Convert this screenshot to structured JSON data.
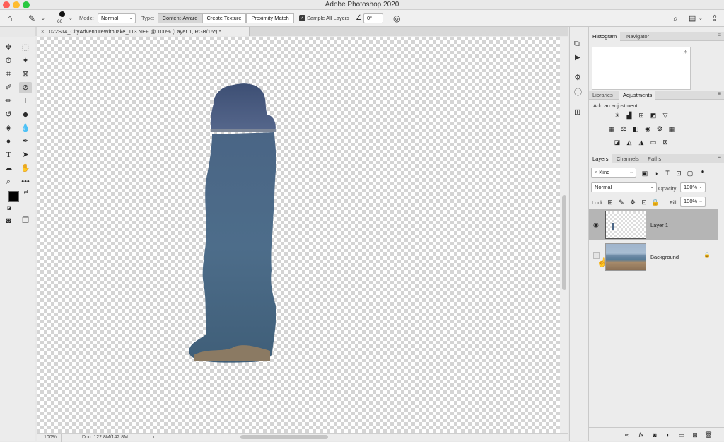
{
  "app": {
    "title": "Adobe Photoshop 2020"
  },
  "colors": {
    "close": "#fe5f57",
    "minimize": "#febc2e",
    "zoom": "#28c840",
    "layer_selected": "#b5b5b5"
  },
  "options_bar": {
    "brush_size": "60",
    "mode_label": "Mode:",
    "mode_value": "Normal",
    "type_label": "Type:",
    "type_options": [
      "Content-Aware",
      "Create Texture",
      "Proximity Match"
    ],
    "type_selected": "Content-Aware",
    "sample_all_layers": "Sample All Layers",
    "sample_all_layers_checked": true,
    "angle_value": "0°"
  },
  "document": {
    "tab_title": "022S14_CityAdventureWithJake_113.NEF @ 100% (Layer 1, RGB/16*) *",
    "zoom": "100%",
    "doc_size": "Doc: 122.8M/142.8M"
  },
  "panels": {
    "histogram_tabs": [
      "Histogram",
      "Navigator"
    ],
    "adjust_tabs": [
      "Libraries",
      "Adjustments"
    ],
    "add_adjustment": "Add an adjustment",
    "layers_tabs": [
      "Layers",
      "Channels",
      "Paths"
    ],
    "filter_kind": "Kind",
    "blend_mode": "Normal",
    "opacity_label": "Opacity:",
    "opacity_value": "100%",
    "lock_label": "Lock:",
    "fill_label": "Fill:",
    "fill_value": "100%",
    "layers": [
      {
        "name": "Layer 1",
        "visible": true,
        "selected": true
      },
      {
        "name": "Background",
        "visible": false,
        "selected": false,
        "locked": true
      }
    ]
  }
}
